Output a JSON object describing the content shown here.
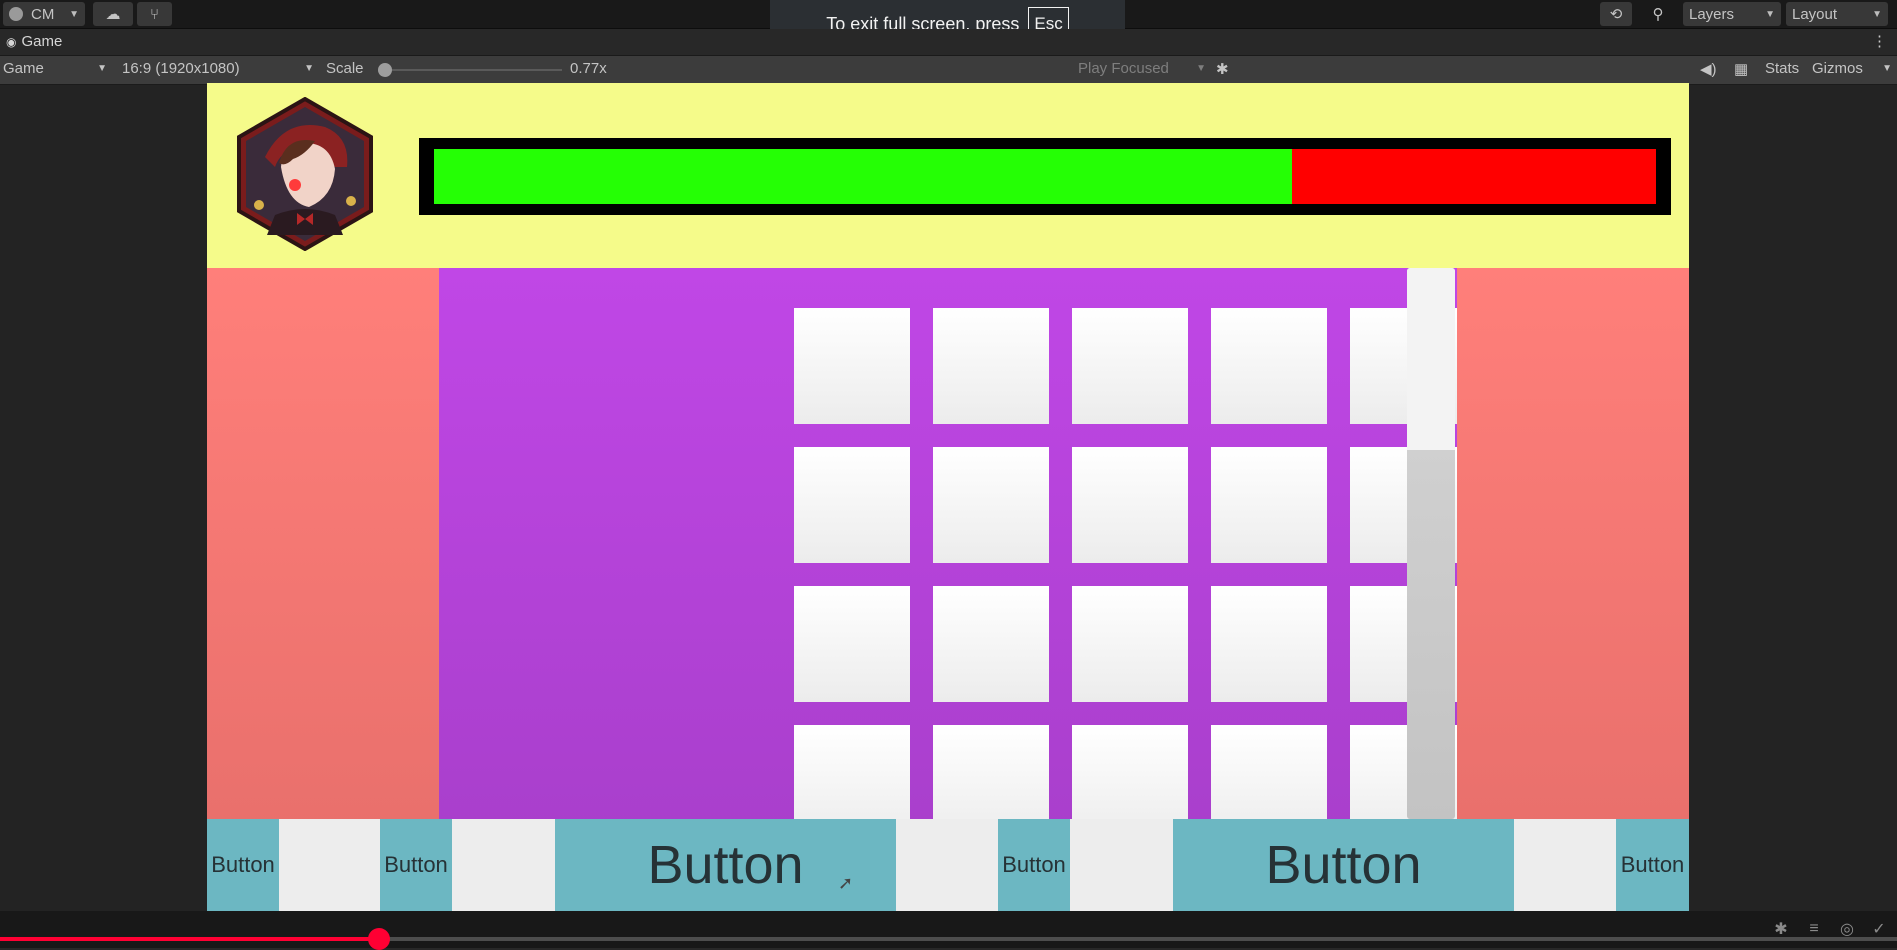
{
  "toolbar": {
    "account_label": "CM",
    "layers_label": "Layers",
    "layout_label": "Layout"
  },
  "fullscreen_toast": {
    "message": "To exit full screen, press",
    "key": "Esc"
  },
  "game_tab": {
    "title": "Game"
  },
  "game_controls": {
    "display_select": "Game",
    "aspect_select": "16:9 (1920x1080)",
    "scale_label": "Scale",
    "scale_value_text": "0.77x",
    "scale_level": 0.04,
    "play_mode_select": "Play Focused",
    "stats_label": "Stats",
    "gizmos_label": "Gizmos"
  },
  "hud": {
    "health_fraction": 0.702,
    "health_color": "#25ff05",
    "damage_color": "#ff0000"
  },
  "grid": {
    "rows": 4,
    "columns": 5
  },
  "scroll": {
    "handle_fraction": 0.33
  },
  "buttons": [
    {
      "label": "Button",
      "size": "small"
    },
    {
      "label": "Button",
      "size": "small"
    },
    {
      "label": "Button",
      "size": "big"
    },
    {
      "label": "Button",
      "size": "small"
    },
    {
      "label": "Button",
      "size": "big"
    },
    {
      "label": "Button",
      "size": "small"
    }
  ],
  "video": {
    "progress_fraction": 0.2
  },
  "colors": {
    "hud_bg": "#f5fb8a",
    "side_panel": "#ff7f7a",
    "grid_panel": "#c047e6",
    "button_bg": "#6cb7c2"
  }
}
